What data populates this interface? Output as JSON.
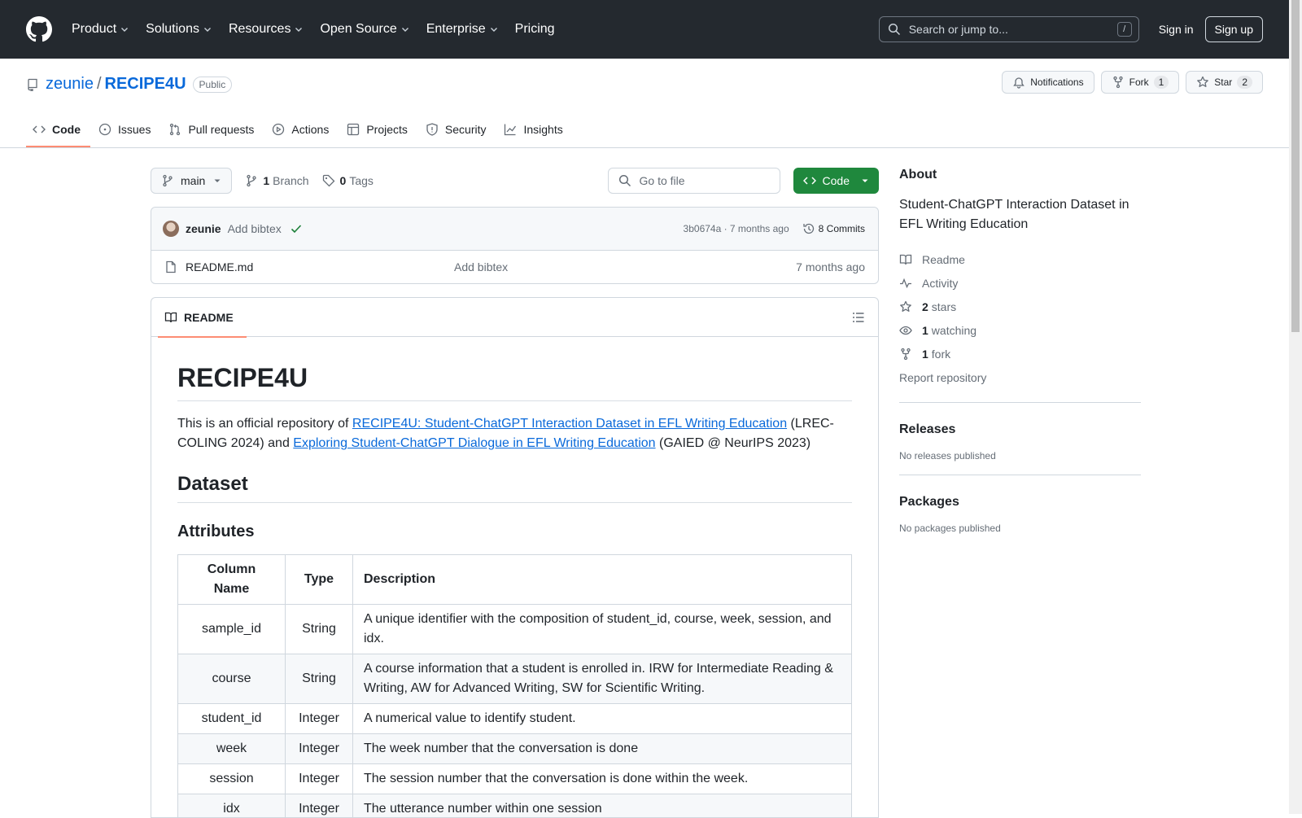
{
  "header": {
    "nav": [
      {
        "label": "Product",
        "has_menu": true
      },
      {
        "label": "Solutions",
        "has_menu": true
      },
      {
        "label": "Resources",
        "has_menu": true
      },
      {
        "label": "Open Source",
        "has_menu": true
      },
      {
        "label": "Enterprise",
        "has_menu": true
      },
      {
        "label": "Pricing",
        "has_menu": false
      }
    ],
    "search_placeholder": "Search or jump to...",
    "search_key": "/",
    "sign_in": "Sign in",
    "sign_up": "Sign up"
  },
  "repo": {
    "owner": "zeunie",
    "separator": "/",
    "name": "RECIPE4U",
    "visibility": "Public",
    "notifications_label": "Notifications",
    "fork_label": "Fork",
    "fork_count": "1",
    "star_label": "Star",
    "star_count": "2"
  },
  "tabs": [
    {
      "label": "Code",
      "icon": "code-icon",
      "active": true
    },
    {
      "label": "Issues",
      "icon": "issue-icon",
      "active": false
    },
    {
      "label": "Pull requests",
      "icon": "pull-request-icon",
      "active": false
    },
    {
      "label": "Actions",
      "icon": "play-icon",
      "active": false
    },
    {
      "label": "Projects",
      "icon": "table-icon",
      "active": false
    },
    {
      "label": "Security",
      "icon": "shield-icon",
      "active": false
    },
    {
      "label": "Insights",
      "icon": "graph-icon",
      "active": false
    }
  ],
  "toolbar": {
    "branch": "main",
    "branch_count": "1",
    "branch_label": "Branch",
    "tag_count": "0",
    "tag_label": "Tags",
    "go_to_file": "Go to file",
    "code_button": "Code"
  },
  "commit": {
    "author": "zeunie",
    "message": "Add bibtex",
    "hash_time": "3b0674a · 7 months ago",
    "commits": "8 Commits"
  },
  "files": [
    {
      "name": "README.md",
      "message": "Add bibtex",
      "time": "7 months ago"
    }
  ],
  "readme": {
    "tab_label": "README",
    "title": "RECIPE4U",
    "intro_1": "This is an official repository of ",
    "link_1": "RECIPE4U: Student-ChatGPT Interaction Dataset in EFL Writing Education",
    "intro_2": " (LREC-COLING 2024) and ",
    "link_2": "Exploring Student-ChatGPT Dialogue in EFL Writing Education",
    "intro_3": " (GAIED @ NeurIPS 2023)",
    "h2_dataset": "Dataset",
    "h3_attributes": "Attributes",
    "table_headers": [
      "Column Name",
      "Type",
      "Description"
    ],
    "table_rows": [
      [
        "sample_id",
        "String",
        "A unique identifier with the composition of student_id, course, week, session, and idx."
      ],
      [
        "course",
        "String",
        "A course information that a student is enrolled in. IRW for Intermediate Reading & Writing, AW for Advanced Writing, SW for Scientific Writing."
      ],
      [
        "student_id",
        "Integer",
        "A numerical value to identify student."
      ],
      [
        "week",
        "Integer",
        "The week number that the conversation is done"
      ],
      [
        "session",
        "Integer",
        "The session number that the conversation is done within the week."
      ],
      [
        "idx",
        "Integer",
        "The utterance number within one session"
      ]
    ]
  },
  "about": {
    "heading": "About",
    "description": "Student-ChatGPT Interaction Dataset in EFL Writing Education",
    "readme": "Readme",
    "activity": "Activity",
    "stars_count": "2",
    "stars_label": "stars",
    "watching_count": "1",
    "watching_label": "watching",
    "fork_count": "1",
    "fork_label": "fork",
    "report": "Report repository"
  },
  "releases": {
    "heading": "Releases",
    "empty": "No releases published"
  },
  "packages": {
    "heading": "Packages",
    "empty": "No packages published"
  },
  "colors": {
    "header_bg": "#24292f",
    "accent_link": "#0969da",
    "code_button": "#1f883d",
    "tab_underline": "#fd8c73"
  }
}
